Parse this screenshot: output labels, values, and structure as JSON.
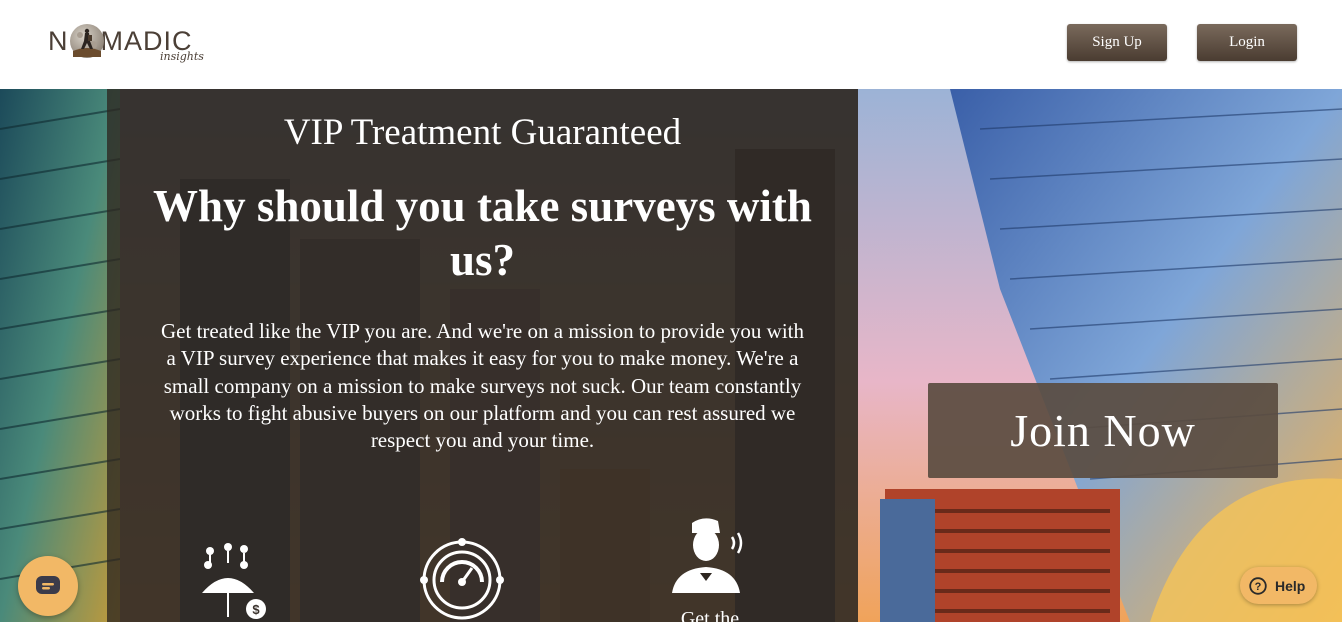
{
  "brand": {
    "logo_text_left": "N",
    "logo_text_right": "MADIC",
    "logo_sub": "insights"
  },
  "header": {
    "signup_label": "Sign Up",
    "login_label": "Login"
  },
  "hero": {
    "kicker": "VIP Treatment Guaranteed",
    "headline": "Why should you take surveys with us?",
    "paragraph": "Get treated like the VIP you are. And we're on a mission to provide you with a VIP survey experience that makes it easy for you to make money. We're a small company on a mission to make surveys not suck. Our team constantly works to fight abusive buyers on our platform and you can rest assured we respect you and your time.",
    "join_label": "Join Now",
    "features": [
      {
        "icon": "umbrella-money-icon",
        "label": ""
      },
      {
        "icon": "speedometer-gear-icon",
        "label": ""
      },
      {
        "icon": "support-agent-icon",
        "label": "Get the"
      }
    ]
  },
  "widgets": {
    "chat_icon": "chat-icon",
    "help_label": "Help",
    "help_icon": "question-circle-icon"
  },
  "colors": {
    "button_brown_top": "#7a6a5c",
    "button_brown_bottom": "#4a3c31",
    "logo_text": "#4b3f36",
    "widget_orange": "#f2b866",
    "panel_overlay": "#2d2620"
  }
}
